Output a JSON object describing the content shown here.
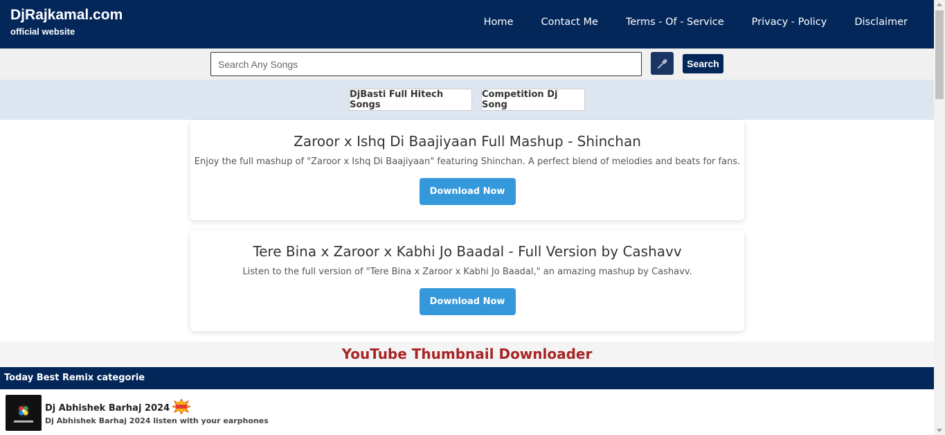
{
  "header": {
    "brand_title": "DjRajkamal.com",
    "brand_subtitle": "official website",
    "nav": [
      "Home",
      "Contact Me",
      "Terms - Of - Service",
      "Privacy - Policy",
      "Disclaimer"
    ]
  },
  "search": {
    "placeholder": "Search Any Songs",
    "button_label": "Search",
    "mic_icon": "microphone-icon"
  },
  "categories": [
    "DjBasti Full Hitech Songs",
    "Competition Dj Song"
  ],
  "cards": [
    {
      "title": "Zaroor x Ishq Di Baajiyaan Full Mashup - Shinchan",
      "description": "Enjoy the full mashup of \"Zaroor x Ishq Di Baajiyaan\" featuring Shinchan. A perfect blend of melodies and beats for fans.",
      "button_label": "Download Now"
    },
    {
      "title": "Tere Bina x Zaroor x Kabhi Jo Baadal - Full Version by Cashavv",
      "description": "Listen to the full version of \"Tere Bina x Zaroor x Kabhi Jo Baadal,\" an amazing mashup by Cashavv.",
      "button_label": "Download Now"
    }
  ],
  "tool_link": "YouTube Thumbnail Downloader",
  "remix": {
    "heading": "Today Best Remix categorie",
    "items": [
      {
        "title": "Dj Abhishek Barhaj 2024",
        "subtitle": "Dj Abhishek Barhaj 2024 listen with your earphones",
        "badge_icon": "new-badge-icon"
      }
    ]
  },
  "colors": {
    "header_bg": "#04275a",
    "download_button": "#3498db",
    "tool_link": "#a82424"
  }
}
